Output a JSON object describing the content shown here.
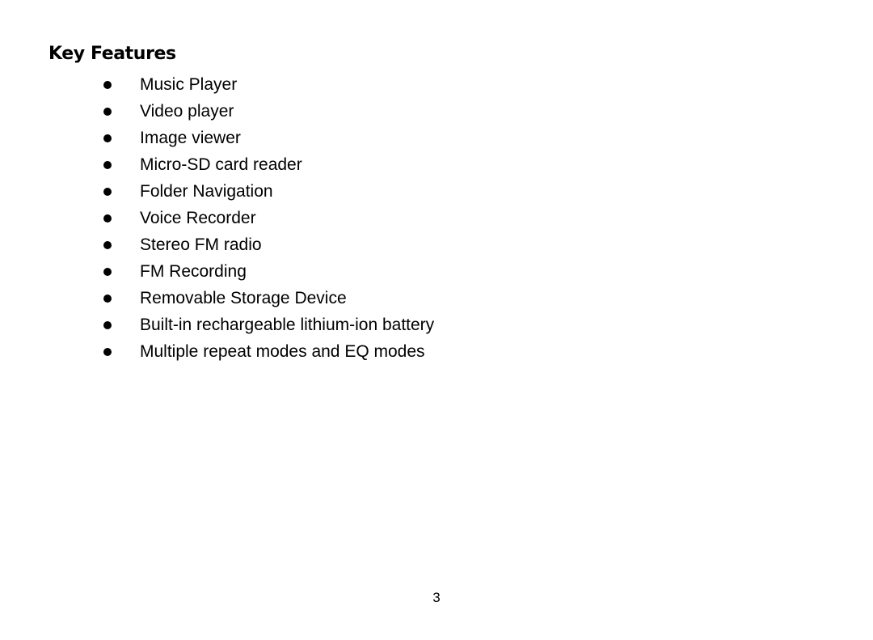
{
  "document": {
    "heading": "Key Features",
    "page_number": "3",
    "background_color": "#ffffff",
    "text_color": "#000000"
  },
  "features": {
    "bullet_glyph": "filled-circle",
    "items": [
      {
        "label": "Music Player"
      },
      {
        "label": "Video player"
      },
      {
        "label": "Image viewer"
      },
      {
        "label": "Micro-SD card reader"
      },
      {
        "label": "Folder Navigation"
      },
      {
        "label": "Voice Recorder"
      },
      {
        "label": "Stereo FM radio"
      },
      {
        "label": "FM Recording"
      },
      {
        "label": "Removable Storage Device"
      },
      {
        "label": "Built-in rechargeable lithium-ion battery"
      },
      {
        "label": "Multiple repeat modes and EQ modes"
      }
    ]
  }
}
